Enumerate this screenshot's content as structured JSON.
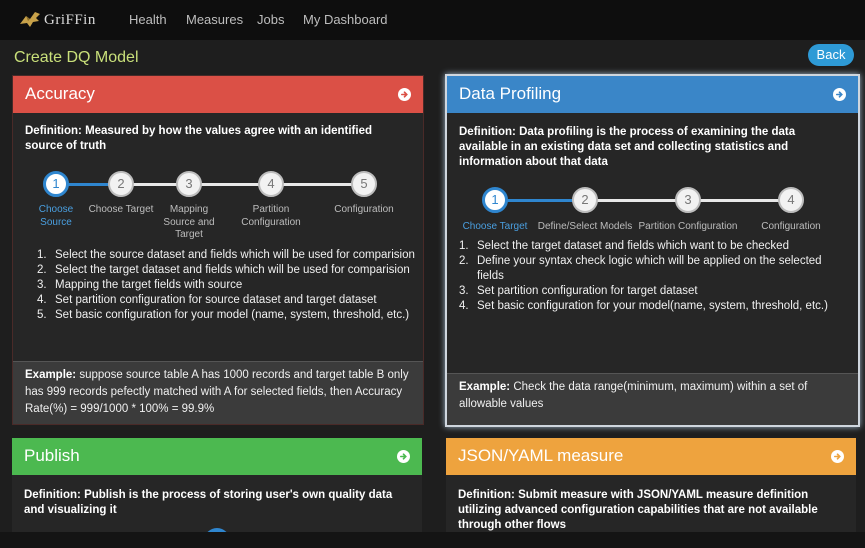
{
  "app": {
    "name": "GriFFin"
  },
  "nav": {
    "items": [
      "Health",
      "Measures",
      "Jobs",
      "My Dashboard"
    ]
  },
  "page": {
    "title": "Create DQ Model",
    "back_label": "Back"
  },
  "colors": {
    "accuracy": "#db5046",
    "profiling": "#3a86c8",
    "publish": "#4cb950",
    "json": "#eea33e",
    "accent": "#2f86cf",
    "title": "#c9e07a"
  },
  "accuracy": {
    "title": "Accuracy",
    "definition_label": "Definition:",
    "definition": "Measured by how the values agree with an identified source of truth",
    "steps": [
      {
        "num": "1",
        "label": "Choose Source"
      },
      {
        "num": "2",
        "label": "Choose Target"
      },
      {
        "num": "3",
        "label": "Mapping Source and Target"
      },
      {
        "num": "4",
        "label": "Partition Configuration"
      },
      {
        "num": "5",
        "label": "Configuration"
      }
    ],
    "instructions": [
      "Select the source dataset and fields which will be used for comparision",
      "Select the target dataset and fields which will be used for comparision",
      "Mapping the target fields with source",
      "Set partition configuration for source dataset and target dataset",
      "Set basic configuration for your model (name, system, threshold, etc.)"
    ],
    "example_label": "Example:",
    "example": "suppose source table A has 1000 records and target table B only has 999 records pefectly matched with A for selected fields, then Accuracy Rate(%) = 999/1000 * 100% = 99.9%"
  },
  "profiling": {
    "title": "Data Profiling",
    "definition_label": "Definition:",
    "definition": "Data profiling is the process of examining the data available in an existing data set and collecting statistics and information about that data",
    "steps": [
      {
        "num": "1",
        "label": "Choose Target"
      },
      {
        "num": "2",
        "label": "Define/Select Models"
      },
      {
        "num": "3",
        "label": "Partition Configuration"
      },
      {
        "num": "4",
        "label": "Configuration"
      }
    ],
    "instructions": [
      "Select the target dataset and fields which want to be checked",
      "Define your syntax check logic which will be applied on the selected fields",
      "Set partition configuration for target dataset",
      "Set basic configuration for your model(name, system, threshold, etc.)"
    ],
    "example_label": "Example:",
    "example": "Check the data range(minimum, maximum) within a set of allowable values"
  },
  "publish": {
    "title": "Publish",
    "definition_label": "Definition:",
    "definition": "Publish is the process of storing user's own quality data and visualizing it"
  },
  "json": {
    "title": "JSON/YAML measure",
    "definition_label": "Definition:",
    "definition": "Submit measure with JSON/YAML measure definition utilizing advanced configuration capabilities that are not available through other flows"
  }
}
